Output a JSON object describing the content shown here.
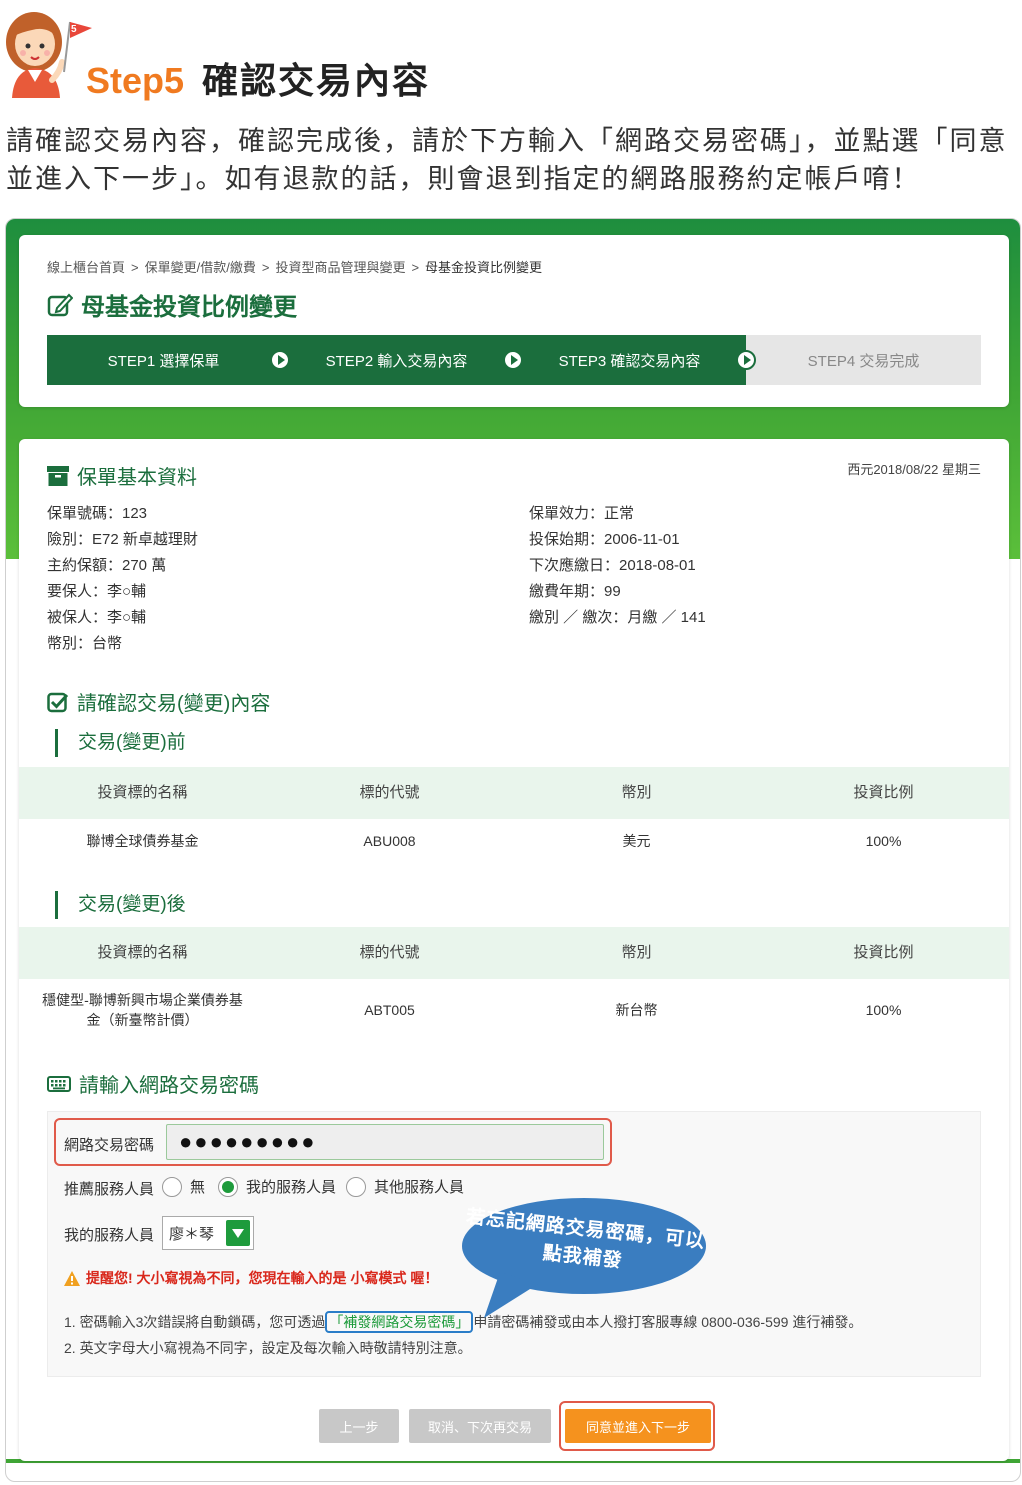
{
  "header": {
    "step_num": "Step5",
    "step_title": "確認交易內容",
    "intro": "請確認交易內容，確認完成後，請於下方輸入「網路交易密碼」，並點選「同意並進入下一步」。如有退款的話，則會退到指定的網路服務約定帳戶唷！",
    "flag_num": "5"
  },
  "breadcrumb": {
    "items": [
      "線上櫃台首頁",
      "保單變更/借款/繳費",
      "投資型商品管理與變更"
    ],
    "current": "母基金投資比例變更",
    "sep": ">"
  },
  "page_title": "母基金投資比例變更",
  "steps": [
    {
      "label": "STEP1 選擇保單"
    },
    {
      "label": "STEP2 輸入交易內容"
    },
    {
      "label": "STEP3 確認交易內容"
    },
    {
      "label": "STEP4 交易完成"
    }
  ],
  "policy": {
    "title": "保單基本資料",
    "date": "西元2018/08/22 星期三",
    "left": [
      "保單號碼：123",
      "險別：E72 新卓越理財",
      "主約保額：270 萬",
      "要保人：李○輔",
      "被保人：李○輔",
      "幣別：台幣"
    ],
    "right": [
      "保單效力：正常",
      "投保始期：2006-11-01",
      "下次應繳日：2018-08-01",
      "繳費年期：99",
      "繳別 ／ 繳次：月繳 ／ 141"
    ]
  },
  "confirm": {
    "title": "請確認交易(變更)內容",
    "before_title": "交易(變更)前",
    "after_title": "交易(變更)後",
    "headers": [
      "投資標的名稱",
      "標的代號",
      "幣別",
      "投資比例"
    ],
    "before_rows": [
      [
        "聯博全球債券基金",
        "ABU008",
        "美元",
        "100%"
      ]
    ],
    "after_rows": [
      [
        "穩健型-聯博新興市場企業債券基金（新臺幣計價）",
        "ABT005",
        "新台幣",
        "100%"
      ]
    ]
  },
  "password": {
    "title": "請輸入網路交易密碼",
    "field_label": "網路交易密碼",
    "field_value": "●●●●●●●●●",
    "referrer_label": "推薦服務人員",
    "options": [
      "無",
      "我的服務人員",
      "其他服務人員"
    ],
    "selected_option": "我的服務人員",
    "my_agent_label": "我的服務人員",
    "my_agent_value": "廖＊琴",
    "warning": "提醒您! 大小寫視為不同，您現在輸入的是 小寫模式 喔！",
    "note1_prefix": "1. 密碼輸入3次錯誤將自動鎖碼，您可透過",
    "note1_link": "「補發網路交易密碼」",
    "note1_suffix": "申請密碼補發或由本人撥打客服專線 0800-036-599 進行補發。",
    "note2": "2. 英文字母大小寫視為不同字，設定及每次輸入時敬請特別注意。",
    "bubble_text": "若忘記網路交易密碼，可以點我補發"
  },
  "buttons": {
    "prev": "上一步",
    "cancel": "取消、下次再交易",
    "next": "同意並進入下一步"
  },
  "colors": {
    "brand_green": "#1b6e3d",
    "accent_orange": "#f07a20",
    "button_orange": "#f5921e",
    "highlight_red": "#e05a4a",
    "bubble_blue": "#3a7dc0"
  }
}
